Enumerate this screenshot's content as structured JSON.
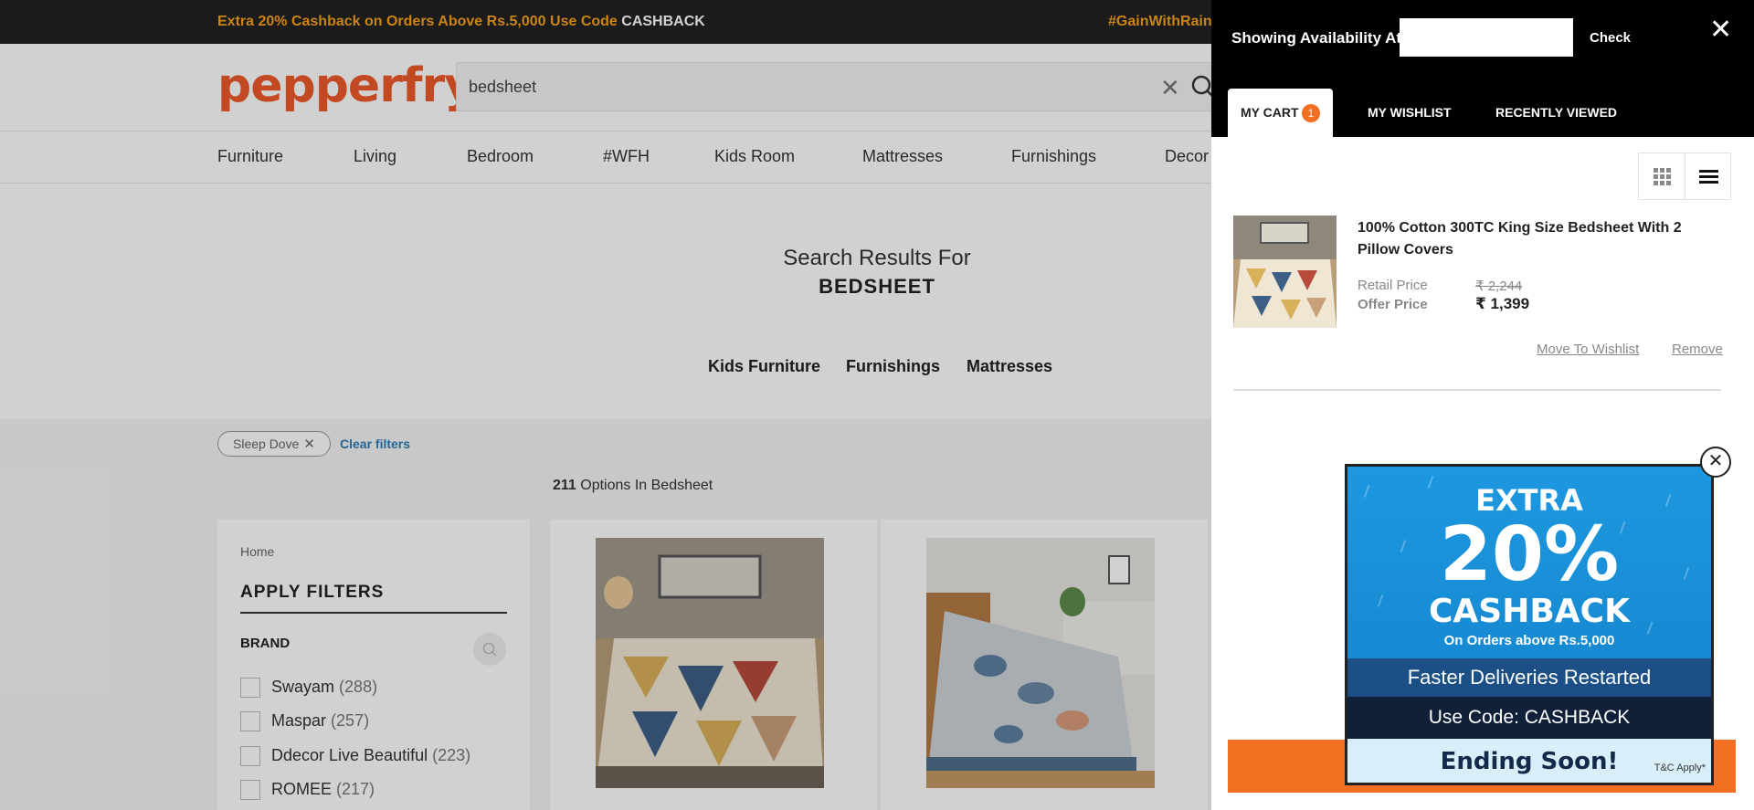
{
  "promo_bar": {
    "text": "Extra 20% Cashback on Orders Above Rs.5,000 Use Code ",
    "code": "CASHBACK",
    "hashtag": "#GainWithRain"
  },
  "header": {
    "logo": "pepperfry",
    "search_value": "bedsheet"
  },
  "nav": {
    "items": [
      "Furniture",
      "Living",
      "Bedroom",
      "#WFH",
      "Kids Room",
      "Mattresses",
      "Furnishings",
      "Decor"
    ]
  },
  "results": {
    "title": "Search Results For",
    "query": "BEDSHEET",
    "categories": [
      "Kids Furniture",
      "Furnishings",
      "Mattresses"
    ]
  },
  "filters": {
    "chip": "Sleep Dove",
    "clear": "Clear filters",
    "options_count": "211",
    "options_text": " Options In Bedsheet",
    "breadcrumb": "Home",
    "apply_title": "APPLY FILTERS",
    "brand_title": "BRAND",
    "brands": [
      {
        "name": "Swayam",
        "count": "(288)"
      },
      {
        "name": "Maspar",
        "count": "(257)"
      },
      {
        "name": "Ddecor Live Beautiful",
        "count": "(223)"
      },
      {
        "name": "ROMEE",
        "count": "(217)"
      }
    ]
  },
  "drawer": {
    "availability_label": "Showing Availability At",
    "availability_placeholder": "",
    "check_label": "Check",
    "tabs": {
      "cart": "MY CART",
      "cart_count": "1",
      "wishlist": "MY WISHLIST",
      "recent": "RECENTLY VIEWED"
    },
    "item": {
      "name": "100% Cotton 300TC King Size Bedsheet With 2 Pillow Covers",
      "retail_label": "Retail Price",
      "retail_price": "₹ 2,244",
      "offer_label": "Offer Price",
      "offer_price": "₹ 1,399",
      "move_to_wishlist": "Move To Wishlist",
      "remove": "Remove"
    }
  },
  "popup": {
    "extra": "EXTRA",
    "percent": "20%",
    "cashback": "CASHBACK",
    "orders": "On Orders above Rs.5,000",
    "faster": "Faster Deliveries Restarted",
    "code": "Use Code:  CASHBACK",
    "ending": "Ending Soon!",
    "tc": "T&C Apply*"
  },
  "colors": {
    "brand_orange": "#ee5a2a",
    "promo_yellow": "#f7a21b",
    "badge_orange": "#f36f21",
    "link_blue": "#2a7db7"
  }
}
